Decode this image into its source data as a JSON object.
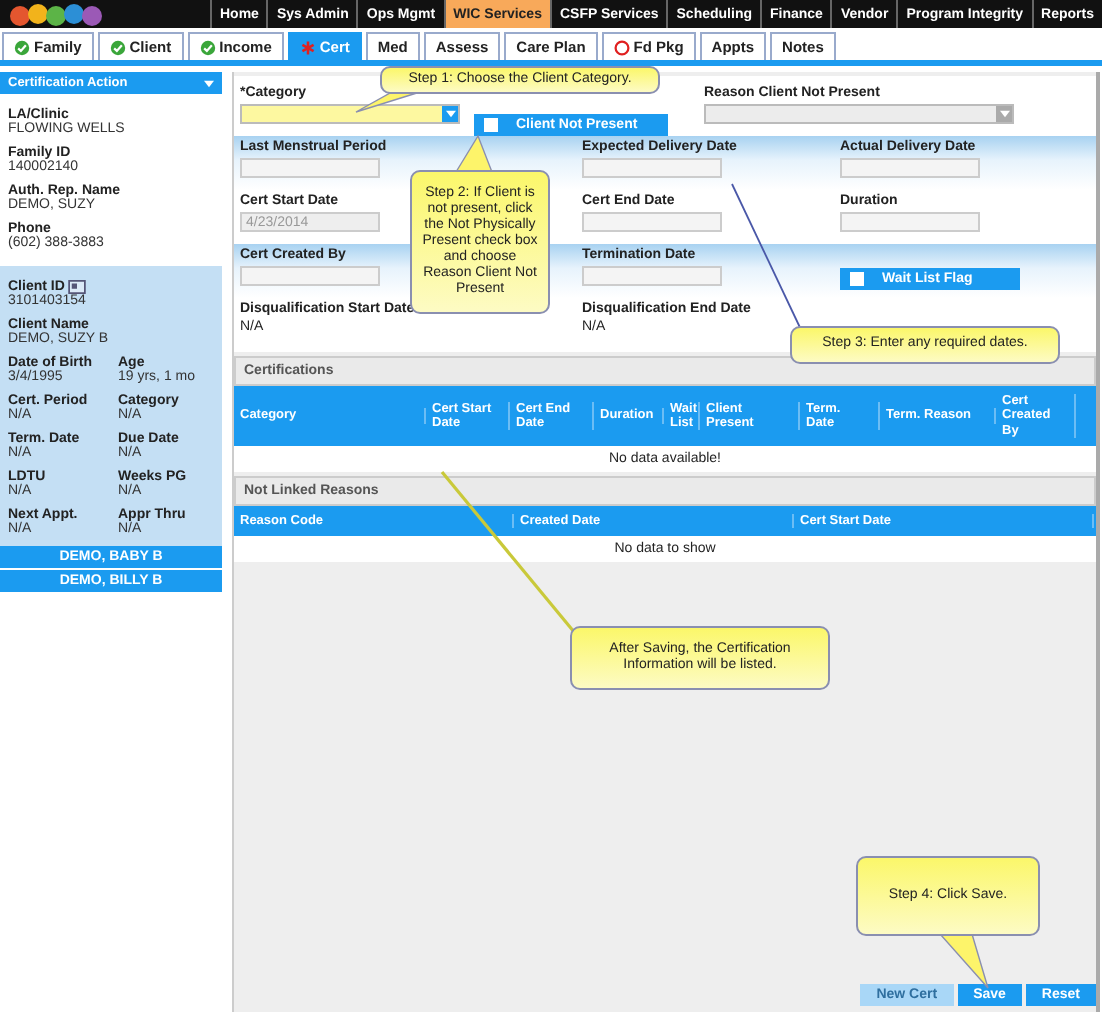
{
  "nav": [
    {
      "label": "Home",
      "selected": false
    },
    {
      "label": "Sys Admin",
      "selected": false
    },
    {
      "label": "Ops Mgmt",
      "selected": false
    },
    {
      "label": "WIC Services",
      "selected": true
    },
    {
      "label": "CSFP Services",
      "selected": false
    },
    {
      "label": "Scheduling",
      "selected": false
    },
    {
      "label": "Finance",
      "selected": false
    },
    {
      "label": "Vendor",
      "selected": false
    },
    {
      "label": "Program Integrity",
      "selected": false
    },
    {
      "label": "Reports",
      "selected": false
    }
  ],
  "tabs": [
    {
      "label": "Family",
      "kind": "complete",
      "selected": false
    },
    {
      "label": "Client",
      "kind": "complete",
      "selected": false
    },
    {
      "label": "Income",
      "kind": "complete",
      "selected": false
    },
    {
      "label": "Cert",
      "kind": "required",
      "selected": true
    },
    {
      "label": "Med",
      "kind": "plain",
      "selected": false
    },
    {
      "label": "Assess",
      "kind": "plain",
      "selected": false
    },
    {
      "label": "Care Plan",
      "kind": "plain",
      "selected": false
    },
    {
      "label": "Fd Pkg",
      "kind": "alert",
      "selected": false
    },
    {
      "label": "Appts",
      "kind": "plain",
      "selected": false
    },
    {
      "label": "Notes",
      "kind": "plain",
      "selected": false
    }
  ],
  "sidebar": {
    "action": "Certification Action",
    "household": [
      {
        "label": "LA/Clinic",
        "value": "FLOWING WELLS"
      },
      {
        "label": "Family ID",
        "value": "140002140"
      },
      {
        "label": "Auth. Rep. Name",
        "value": "DEMO, SUZY"
      },
      {
        "label": "Phone",
        "value": "(602) 388-3883"
      }
    ],
    "client_id": {
      "label": "Client ID",
      "value": "3101403154"
    },
    "client_name": {
      "label": "Client Name",
      "value": "DEMO, SUZY B"
    },
    "client_pairs": [
      [
        {
          "label": "Date of Birth",
          "value": "3/4/1995"
        },
        {
          "label": "Age",
          "value": "19 yrs, 1 mo"
        }
      ],
      [
        {
          "label": "Cert. Period",
          "value": "N/A"
        },
        {
          "label": "Category",
          "value": "N/A"
        }
      ],
      [
        {
          "label": "Term. Date",
          "value": "N/A"
        },
        {
          "label": "Due Date",
          "value": "N/A"
        }
      ],
      [
        {
          "label": "LDTU",
          "value": "N/A"
        },
        {
          "label": "Weeks PG",
          "value": "N/A"
        }
      ],
      [
        {
          "label": "Next Appt.",
          "value": "N/A"
        },
        {
          "label": "Appr Thru",
          "value": "N/A"
        }
      ]
    ],
    "members": [
      "DEMO, BABY B",
      "DEMO, BILLY B"
    ]
  },
  "form_rows": [
    [
      {
        "kind": "select",
        "label": "*Category",
        "disabled": false
      },
      {
        "kind": "checkbox",
        "label": "Client Not Present",
        "checked": false
      },
      {
        "kind": "select",
        "label": "Reason Client Not Present",
        "disabled": true
      }
    ],
    [
      {
        "kind": "input",
        "label": "Last Menstrual Period"
      },
      {
        "kind": "input",
        "label": "Expected Delivery Date"
      },
      {
        "kind": "input",
        "label": "Actual Delivery Date"
      }
    ],
    [
      {
        "kind": "input",
        "label": "Cert Start Date",
        "value": "4/23/2014",
        "disabled": true
      },
      {
        "kind": "input",
        "label": "Cert End Date"
      },
      {
        "kind": "input",
        "label": "Duration"
      }
    ],
    [
      {
        "kind": "input",
        "label": "Cert Created By"
      },
      {
        "kind": "input",
        "label": "Termination Date"
      },
      {
        "kind": "checkbox",
        "label": "Wait List Flag",
        "checked": false
      }
    ],
    [
      {
        "kind": "text",
        "label": "Disqualification Start Date",
        "value": "N/A"
      },
      {
        "kind": "text",
        "label": "Disqualification End Date",
        "value": "N/A"
      }
    ]
  ],
  "sections": [
    {
      "title": "Certifications",
      "columns": [
        "Category",
        "Cert Start Date",
        "Cert End Date",
        "Duration",
        "Wait List",
        "Client Present",
        "Term. Date",
        "Term. Reason",
        "Cert Created By"
      ],
      "empty": "No data available!"
    },
    {
      "title": "Not Linked Reasons",
      "columns": [
        "Reason Code",
        "Created Date",
        "Cert Start Date"
      ],
      "empty": "No data to show"
    }
  ],
  "buttons": [
    {
      "label": "New Cert",
      "disabled": true
    },
    {
      "label": "Save",
      "disabled": false
    },
    {
      "label": "Reset",
      "disabled": false
    }
  ],
  "callouts": [
    "Step 1: Choose the Client Category.",
    "Step 2: If Client is not present, click the Not Physically Present check box and choose Reason Client Not Present",
    "Step 3: Enter any required dates.",
    "After Saving, the Certification Information will be listed.",
    "Step 4: Click Save."
  ]
}
